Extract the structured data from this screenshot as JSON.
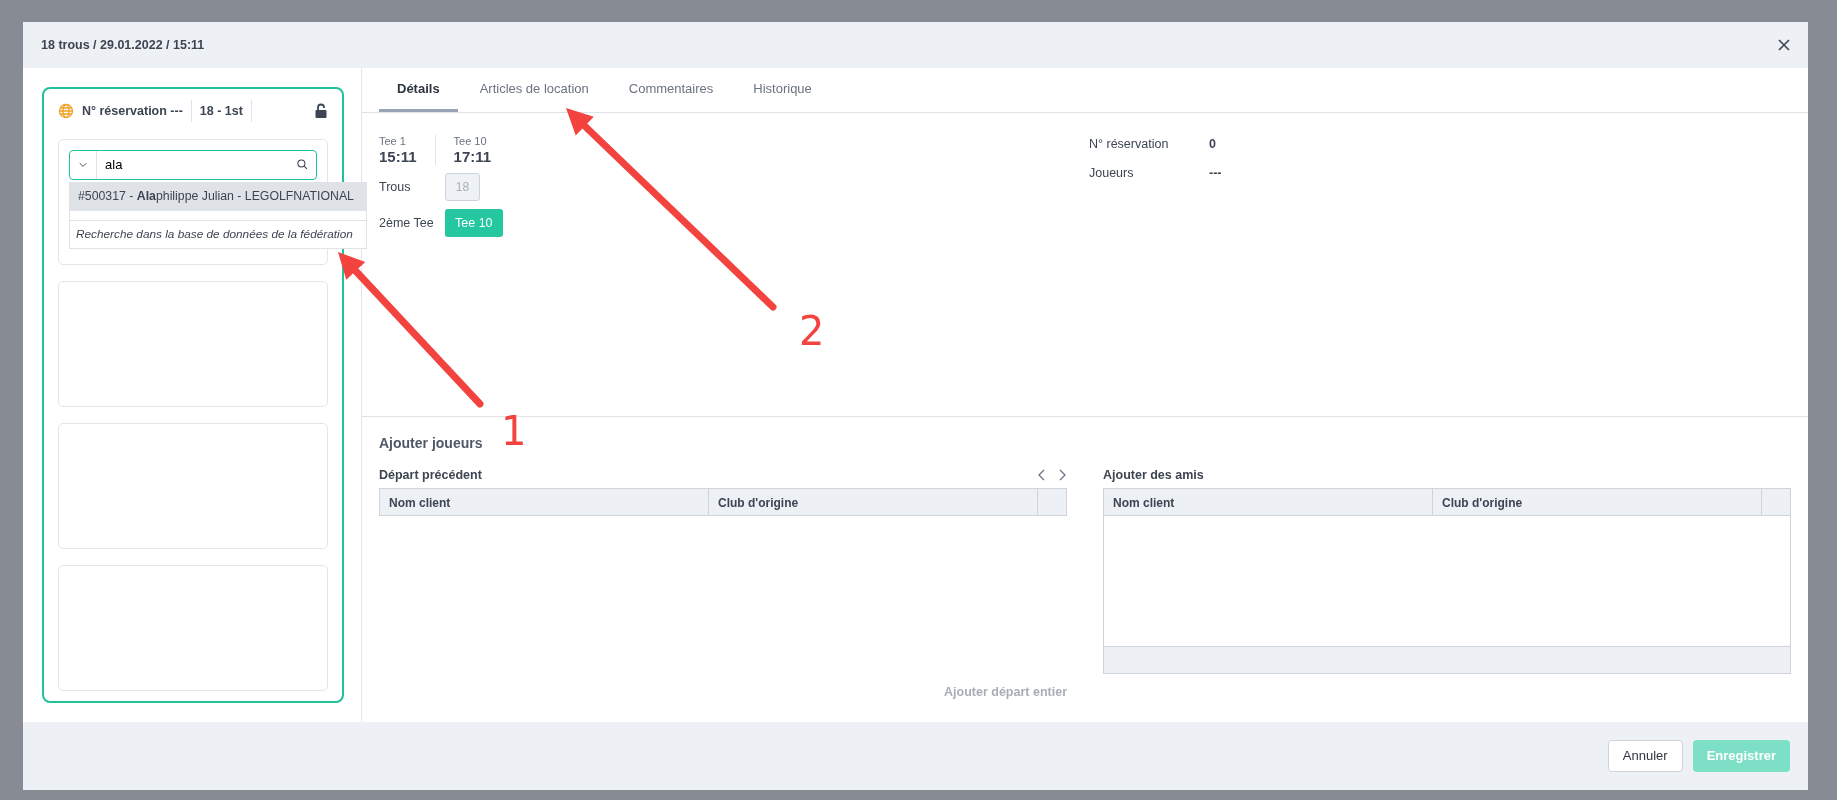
{
  "window": {
    "title": "18 trous / 29.01.2022 / 15:11"
  },
  "booking_card": {
    "reservation": "N° réservation ---",
    "course": "18 - 1st",
    "locked": false,
    "search": {
      "value": "ala",
      "results": [
        {
          "text": "#500317 - **Ala**philippe Julian - LEGOLFNATIONAL",
          "selected": true,
          "kind": "result"
        },
        {
          "text": "Recherche dans la base de données de la fédération",
          "selected": false,
          "kind": "federation"
        }
      ]
    }
  },
  "tabs": [
    {
      "label": "Détails",
      "selected": true
    },
    {
      "label": "Articles de location",
      "selected": false
    },
    {
      "label": "Commentaires",
      "selected": false
    },
    {
      "label": "Historique",
      "selected": false
    }
  ],
  "tee_times": [
    {
      "label": "Tee 1",
      "time": "15:11"
    },
    {
      "label": "Tee 10",
      "time": "17:11"
    }
  ],
  "holes": {
    "label": "Trous",
    "value": "18",
    "disabled": true
  },
  "second_tee": {
    "label": "2ème Tee",
    "button": "Tee 10"
  },
  "info": [
    {
      "label": "N° réservation",
      "value": "0"
    },
    {
      "label": "Joueurs",
      "value": "---"
    }
  ],
  "add_players": {
    "title": "Ajouter joueurs",
    "previous_departure": {
      "title": "Départ précédent",
      "columns": [
        "Nom client",
        "Club d'origine"
      ],
      "action": "Ajouter départ entier"
    },
    "friends": {
      "title": "Ajouter des amis",
      "columns": [
        "Nom client",
        "Club d'origine"
      ]
    }
  },
  "footer": {
    "cancel": "Annuler",
    "save": "Enregistrer",
    "save_disabled": true
  },
  "annotations": [
    {
      "label": "1"
    },
    {
      "label": "2"
    }
  ]
}
